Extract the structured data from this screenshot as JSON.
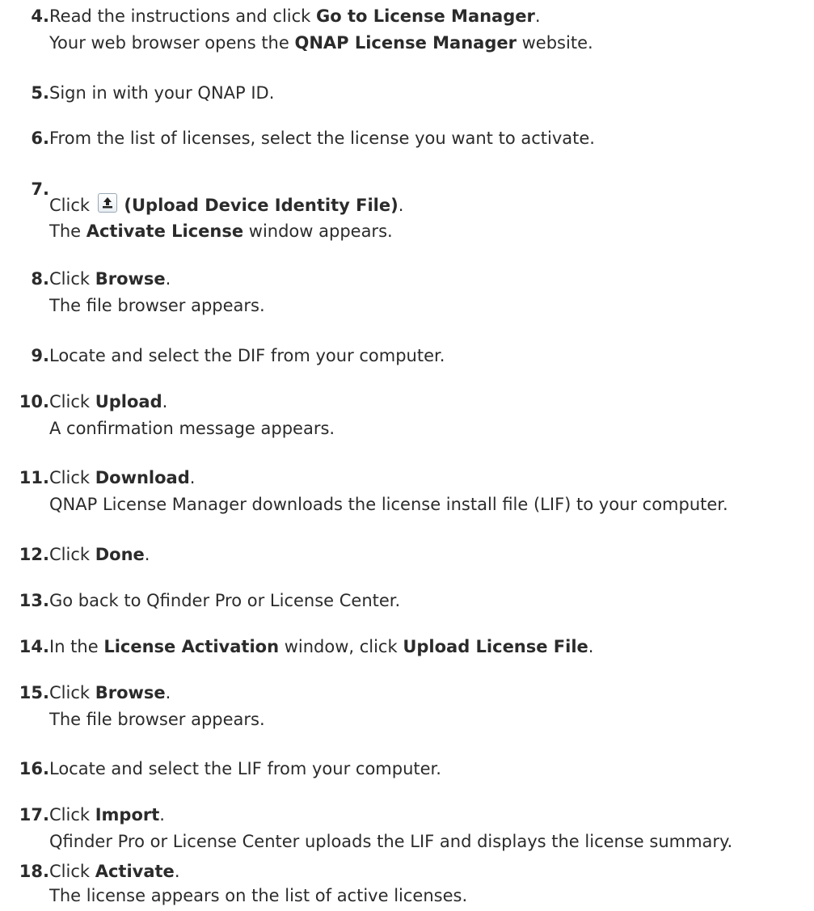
{
  "steps": [
    {
      "number": "4.",
      "line1_pre": "Read the instructions and click ",
      "line1_bold": "Go to License Manager",
      "line1_post": ".",
      "line2_pre": "Your web browser opens the ",
      "line2_bold": "QNAP License Manager",
      "line2_post": " website."
    },
    {
      "number": "5.",
      "line1": "Sign in with your QNAP ID."
    },
    {
      "number": "6.",
      "line1": "From the list of licenses, select the license you want to activate."
    },
    {
      "number": "7.",
      "line1_pre": "Click ",
      "icon": "upload-device-identity-icon",
      "line1_bold": "(Upload Device Identity File)",
      "line1_post": ".",
      "line2_pre": "The ",
      "line2_bold": "Activate License",
      "line2_post": " window appears."
    },
    {
      "number": "8.",
      "line1_pre": "Click ",
      "line1_bold": "Browse",
      "line1_post": ".",
      "line2": "The file browser appears."
    },
    {
      "number": "9.",
      "line1": "Locate and select the DIF from your computer."
    },
    {
      "number": "10.",
      "line1_pre": "Click ",
      "line1_bold": "Upload",
      "line1_post": ".",
      "line2": "A confirmation message appears."
    },
    {
      "number": "11.",
      "line1_pre": "Click ",
      "line1_bold": "Download",
      "line1_post": ".",
      "line2": "QNAP License Manager downloads the license install file (LIF) to your computer."
    },
    {
      "number": "12.",
      "line1_pre": "Click ",
      "line1_bold": "Done",
      "line1_post": "."
    },
    {
      "number": "13.",
      "line1": "Go back to Qfinder Pro or License Center."
    },
    {
      "number": "14.",
      "line1_pre": "In the ",
      "line1_bold": "License Activation",
      "line1_mid": " window, click ",
      "line1_bold2": "Upload License File",
      "line1_post": "."
    },
    {
      "number": "15.",
      "line1_pre": "Click ",
      "line1_bold": "Browse",
      "line1_post": ".",
      "line2": "The file browser appears."
    },
    {
      "number": "16.",
      "line1": "Locate and select the LIF from your computer."
    },
    {
      "number": "17.",
      "line1_pre": "Click ",
      "line1_bold": "Import",
      "line1_post": ".",
      "line2": "Qfinder Pro or License Center uploads the LIF and displays the license summary."
    },
    {
      "number": "18.",
      "line1_pre": "Click ",
      "line1_bold": "Activate",
      "line1_post": ".",
      "line2": "The license appears on the list of active licenses."
    }
  ]
}
